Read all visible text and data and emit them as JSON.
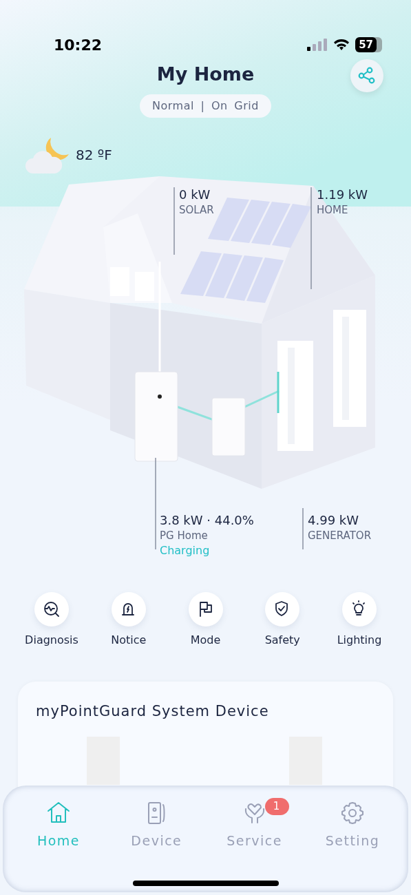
{
  "status_bar": {
    "time": "10:22",
    "battery": "57"
  },
  "header": {
    "title": "My Home",
    "status": "Normal | On Grid"
  },
  "weather": {
    "temperature": "82 ºF"
  },
  "readouts": [
    {
      "value": "0 kW",
      "label": "SOLAR"
    },
    {
      "value": "1.19 kW",
      "label": "HOME"
    },
    {
      "value": "3.8 kW · 44.0%",
      "label": "PG Home",
      "status": "Charging"
    },
    {
      "value": "4.99 kW",
      "label": "GENERATOR"
    }
  ],
  "actions": [
    {
      "label": "Diagnosis"
    },
    {
      "label": "Notice"
    },
    {
      "label": "Mode"
    },
    {
      "label": "Safety"
    },
    {
      "label": "Lighting"
    }
  ],
  "device_card": {
    "title": "myPointGuard System Device"
  },
  "tabs": [
    {
      "label": "Home",
      "selected": true
    },
    {
      "label": "Device",
      "selected": false
    },
    {
      "label": "Service",
      "selected": false,
      "badge": "1"
    },
    {
      "label": "Setting",
      "selected": false
    }
  ]
}
